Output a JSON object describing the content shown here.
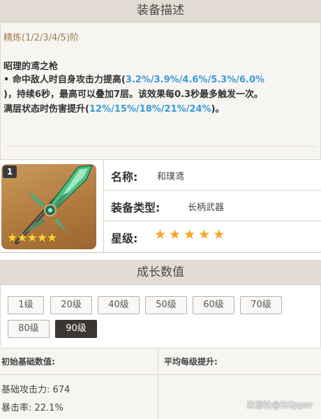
{
  "section1": {
    "title": "装备描述"
  },
  "description": {
    "refine": "精炼(1/2/3/4/5)阶",
    "skill_name": "昭理的鸢之枪",
    "line1_pre": "• 命中敌人时自身攻击力提高(",
    "line1_hl": "3.2%/3.9%/4.6%/5.3%/6.0%",
    "line2_pre": ")，持续6秒，最高可以叠加7层。该效果每0.3秒最多触发一次。",
    "line3_pre": "满层状态时伤害提升(",
    "line3_hl": "12%/15%/18%/21%/24%",
    "line3_post": ")。"
  },
  "card": {
    "badge": "1",
    "stars": "★★★★★"
  },
  "info": {
    "name_label": "名称:",
    "name_value": "和璞鸢",
    "type_label": "装备类型:",
    "type_value": "长柄武器",
    "rarity_label": "星级:",
    "rarity_stars": "★★★★★",
    "rarity_count": 5
  },
  "section2": {
    "title": "成长数值"
  },
  "levels": [
    "1级",
    "20级",
    "40级",
    "50级",
    "60级",
    "70级",
    "80级",
    "90级"
  ],
  "active_level": "90级",
  "stats": {
    "base_header": "初始基础数值:",
    "growth_header": "平均每级提升:",
    "attack": "基础攻击力: 674",
    "crit": "暴击率: 22.1%"
  },
  "watermark": "米游社@SKIpper",
  "colors": {
    "highlight": "#3a9ad9",
    "refine": "#a07b4a",
    "star": "#f5a623",
    "active_level_bg": "#3a3632"
  }
}
